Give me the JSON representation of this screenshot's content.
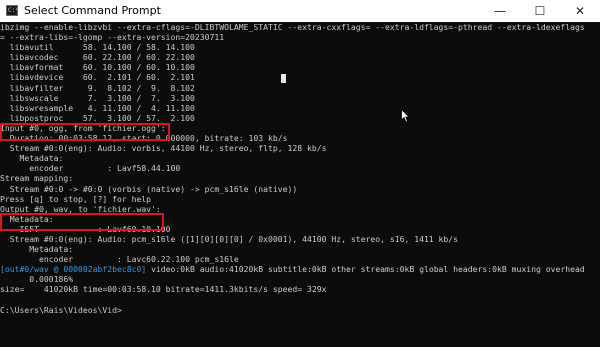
{
  "window": {
    "title": "Select Command Prompt",
    "icon_glyph": "C:\\",
    "icon": "cmd-icon",
    "buttons": {
      "minimize": "—",
      "maximize": "☐",
      "close": "✕"
    }
  },
  "colors": {
    "background": "#0c0c0c",
    "text": "#cccccc",
    "accent_cyan": "#3a96dd",
    "highlight_box": "#e0141c"
  },
  "console": {
    "lines": [
      "ibzimg --enable-libzvbi --extra-cflags=-DLIBTWOLAME_STATIC --extra-cxxflags= --extra-ldflags=-pthread --extra-ldexeflags",
      "= --extra-libs=-lgomp --extra-version=20230711",
      "  libavutil      58. 14.100 / 58. 14.100",
      "  libavcodec     60. 22.100 / 60. 22.100",
      "  libavformat    60. 10.100 / 60. 10.100",
      "  libavdevice    60.  2.101 / 60.  2.101",
      "  libavfilter     9.  8.102 /  9.  8.102",
      "  libswscale      7.  3.100 /  7.  3.100",
      "  libswresample   4. 11.100 /  4. 11.100",
      "  libpostproc    57.  3.100 / 57.  2.100",
      "Input #0, ogg, from 'fichier.ogg':",
      "  Duration: 00:03:58.12, start: 0.000000, bitrate: 103 kb/s",
      "  Stream #0:0(eng): Audio: vorbis, 44100 Hz, stereo, fltp, 128 kb/s",
      "    Metadata:",
      "      encoder         : Lavf58.44.100",
      "Stream mapping:",
      "  Stream #0:0 -> #0:0 (vorbis (native) -> pcm_s16le (native))",
      "Press [q] to stop, [?] for help",
      "Output #0, wav, to 'fichier.wav':",
      "  Metadata:",
      "    ISFT            : Lavf60.10.100",
      "  Stream #0:0(eng): Audio: pcm_s16le ([1][0][0][0] / 0x0001), 44100 Hz, stereo, s16, 1411 kb/s",
      "      Metadata:",
      "        encoder         : Lavc60.22.100 pcm_s16le",
      "",
      "      0.000186%",
      "size=    41020kB time=00:03:58.10 bitrate=1411.3kbits/s speed= 329x",
      "",
      "C:\\Users\\Rais\\Videos\\Vid>"
    ],
    "muxing_line": {
      "prefix": "[out#0/wav @ 000002abf2bec8c0] ",
      "rest": "video:0kB audio:41020kB subtitle:0kB other streams:0kB global headers:0kB muxing overhead"
    }
  }
}
